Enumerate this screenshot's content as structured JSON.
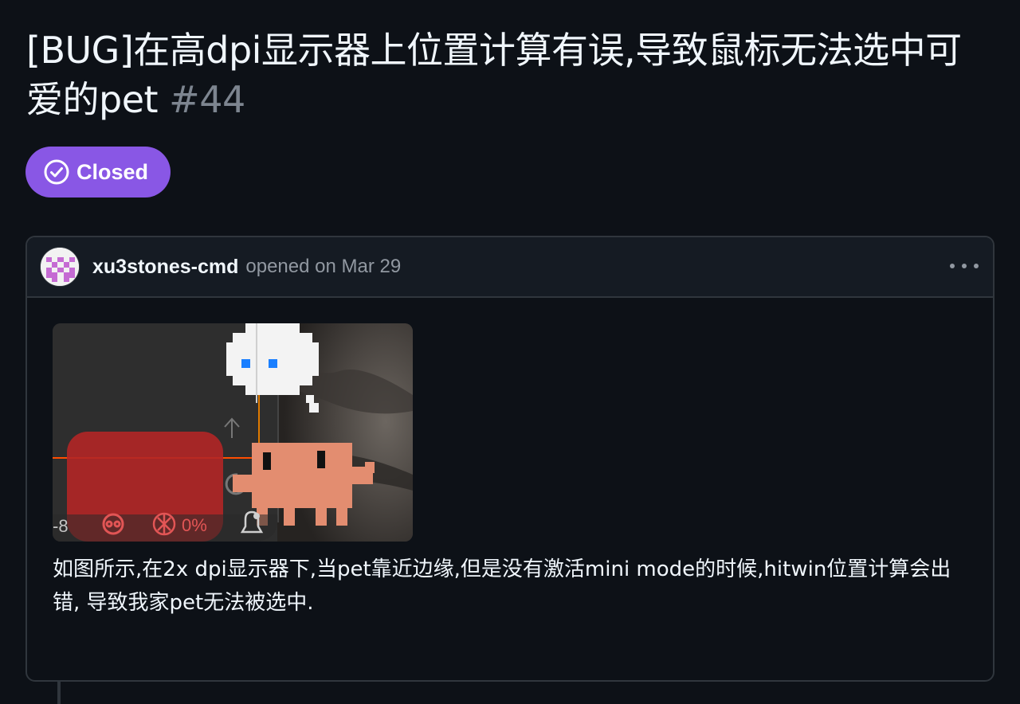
{
  "issue": {
    "title": "[BUG]在高dpi显示器上位置计算有误,导致鼠标无法选中可爱的pet",
    "number": "#44",
    "state_label": "Closed",
    "state_color": "#8957e5"
  },
  "comment": {
    "author": "xu3stones-cmd",
    "meta": "opened on Mar 29",
    "body": "如图所示,在2x dpi显示器下,当pet靠近边缘,但是没有激活mini mode的时候,hitwin位置计算会出错, 导致我家pet无法被选中.",
    "image_taskbar": {
      "left_text": "-8",
      "percent_text": "0%"
    }
  },
  "icons": {
    "state": "check-circle-icon",
    "menu": "kebab-horizontal-icon",
    "avatar": "identicon-avatar"
  }
}
